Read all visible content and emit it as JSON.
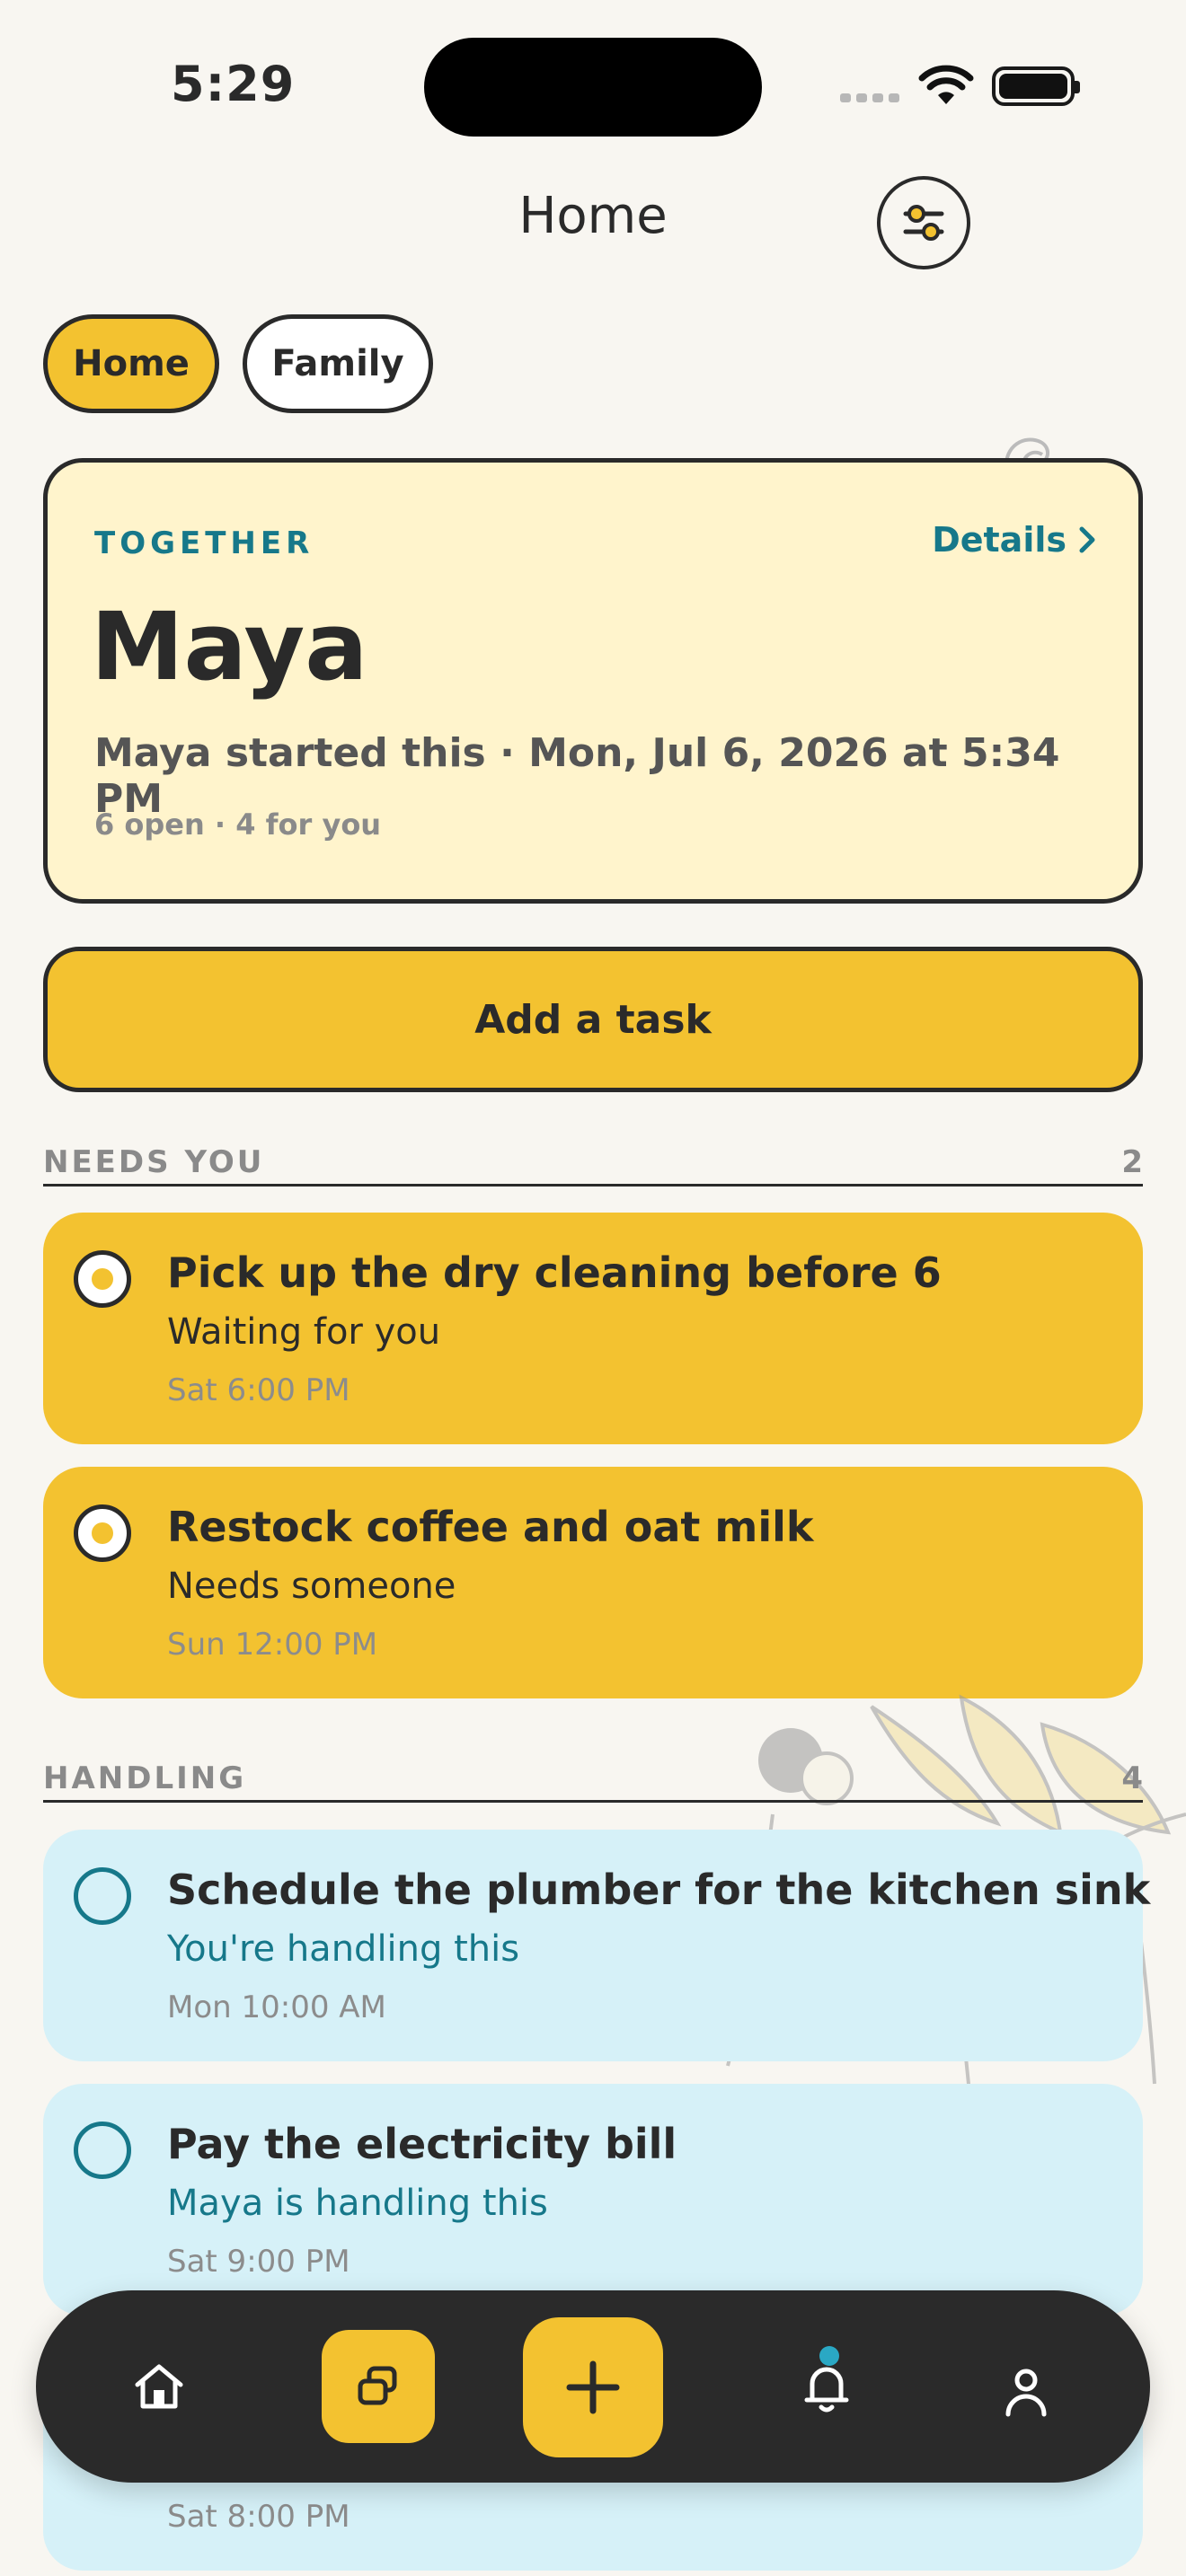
{
  "status_bar": {
    "time": "5:29"
  },
  "header": {
    "title": "Home"
  },
  "chips": [
    {
      "label": "Home",
      "selected": true
    },
    {
      "label": "Family",
      "selected": false
    }
  ],
  "summary": {
    "eyebrow": "TOGETHER",
    "details_label": "Details",
    "name": "Maya",
    "meta": "Maya started this · Mon, Jul 6, 2026 at 5:34 PM",
    "counts": "6 open · 4 for you"
  },
  "add_task_label": "Add a task",
  "sections": {
    "needs_you": {
      "label": "NEEDS YOU",
      "count": "2",
      "tasks": [
        {
          "title": "Pick up the dry cleaning before 6",
          "subtitle": "Waiting for you",
          "time": "Sat 6:00 PM"
        },
        {
          "title": "Restock coffee and oat milk",
          "subtitle": "Needs someone",
          "time": "Sun 12:00 PM"
        }
      ]
    },
    "handling": {
      "label": "HANDLING",
      "count": "4",
      "tasks": [
        {
          "title": "Schedule the plumber for the kitchen sink",
          "subtitle": "You're handling this",
          "time": "Mon 10:00 AM"
        },
        {
          "title": "Pay the electricity bill",
          "subtitle": "Maya is handling this",
          "time": "Sat 9:00 PM"
        },
        {
          "title": "",
          "subtitle": "",
          "time": "Sat 8:00 PM"
        }
      ]
    }
  },
  "nav": {
    "items": [
      "home-icon",
      "tasks-icon",
      "plus-icon",
      "bell-icon",
      "profile-icon"
    ],
    "notification_dot": true
  },
  "colors": {
    "background": "#f8f6f1",
    "accent_yellow": "#f3c230",
    "card_cream": "#fff4cc",
    "task_blue": "#d6f1f8",
    "teal": "#16788a",
    "ink": "#2a2a2a"
  }
}
